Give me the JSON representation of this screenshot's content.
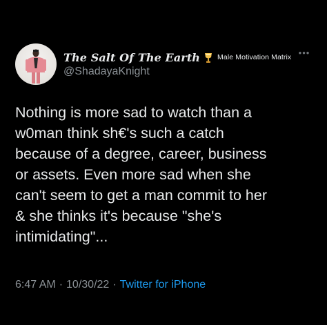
{
  "tweet": {
    "author": {
      "display_name": "The Salt Of The Earth",
      "badge_icon": "trophy-icon",
      "affiliation": "Male Motivation Matrix",
      "handle": "@ShadayaKnight",
      "avatar": "profile-photo-man-in-pink-suit"
    },
    "more_icon": "more-horizontal-icon",
    "text_lines": [
      "Nothing is more sad to watch than a",
      "w0man think sh€'s such a catch",
      "because of a degree, career, business",
      "or assets. Even more sad when she",
      "can't seem to get a man commit to her",
      "& she thinks it's because \"she's",
      "intimidating\"..."
    ],
    "time": "6:47 AM",
    "date": "10/30/22",
    "separator": "·",
    "source": "Twitter for iPhone"
  },
  "colors": {
    "background": "#000000",
    "primary_text": "#e7e9ea",
    "secondary_text": "#8b9196",
    "link": "#1d9bf0"
  }
}
